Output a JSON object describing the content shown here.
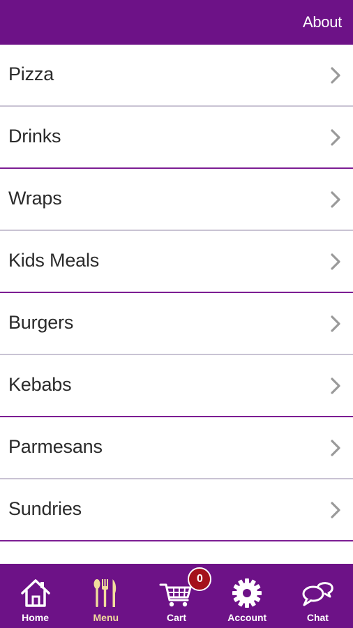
{
  "header": {
    "about_label": "About"
  },
  "menu": {
    "items": [
      {
        "label": "Pizza"
      },
      {
        "label": "Drinks"
      },
      {
        "label": "Wraps"
      },
      {
        "label": "Kids Meals"
      },
      {
        "label": "Burgers"
      },
      {
        "label": "Kebabs"
      },
      {
        "label": "Parmesans"
      },
      {
        "label": "Sundries"
      }
    ]
  },
  "tabbar": {
    "items": [
      {
        "label": "Home",
        "icon": "home-icon"
      },
      {
        "label": "Menu",
        "icon": "fork-knife-icon"
      },
      {
        "label": "Cart",
        "icon": "cart-icon"
      },
      {
        "label": "Account",
        "icon": "gear-icon"
      },
      {
        "label": "Chat",
        "icon": "chat-icon"
      }
    ],
    "active": "Menu",
    "cart_count": "0"
  },
  "colors": {
    "primary": "#6d1287",
    "active_tab": "#f2dd9c",
    "badge": "#a4111b",
    "text": "#2b2b2b"
  }
}
